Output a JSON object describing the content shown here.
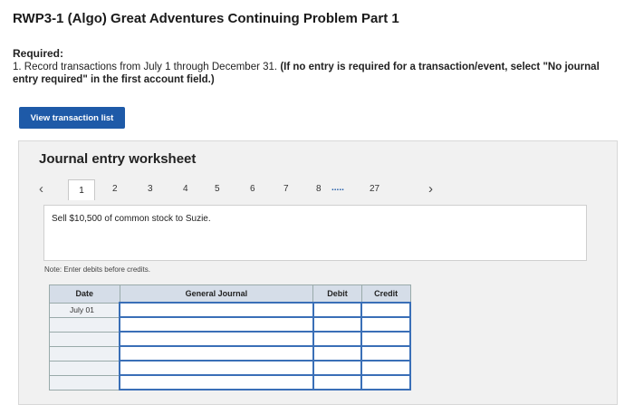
{
  "page": {
    "title": "RWP3-1 (Algo) Great Adventures Continuing Problem Part 1",
    "required_label": "Required:",
    "instruction_plain": "1. Record transactions from July 1 through December 31.",
    "instruction_bold": "(If no entry is required for a transaction/event, select \"No journal entry required\" in the first account field.)",
    "view_button": "View transaction list"
  },
  "worksheet": {
    "title": "Journal entry worksheet",
    "pages": [
      "1",
      "2",
      "3",
      "4",
      "5",
      "6",
      "7",
      "8",
      ".....",
      "27"
    ],
    "active_page": "1",
    "task": "Sell $10,500 of common stock to Suzie.",
    "note": "Note: Enter debits before credits.",
    "columns": [
      "Date",
      "General Journal",
      "Debit",
      "Credit"
    ],
    "rows": [
      {
        "date": "July 01"
      },
      {
        "date": ""
      },
      {
        "date": ""
      },
      {
        "date": ""
      },
      {
        "date": ""
      },
      {
        "date": ""
      }
    ]
  }
}
